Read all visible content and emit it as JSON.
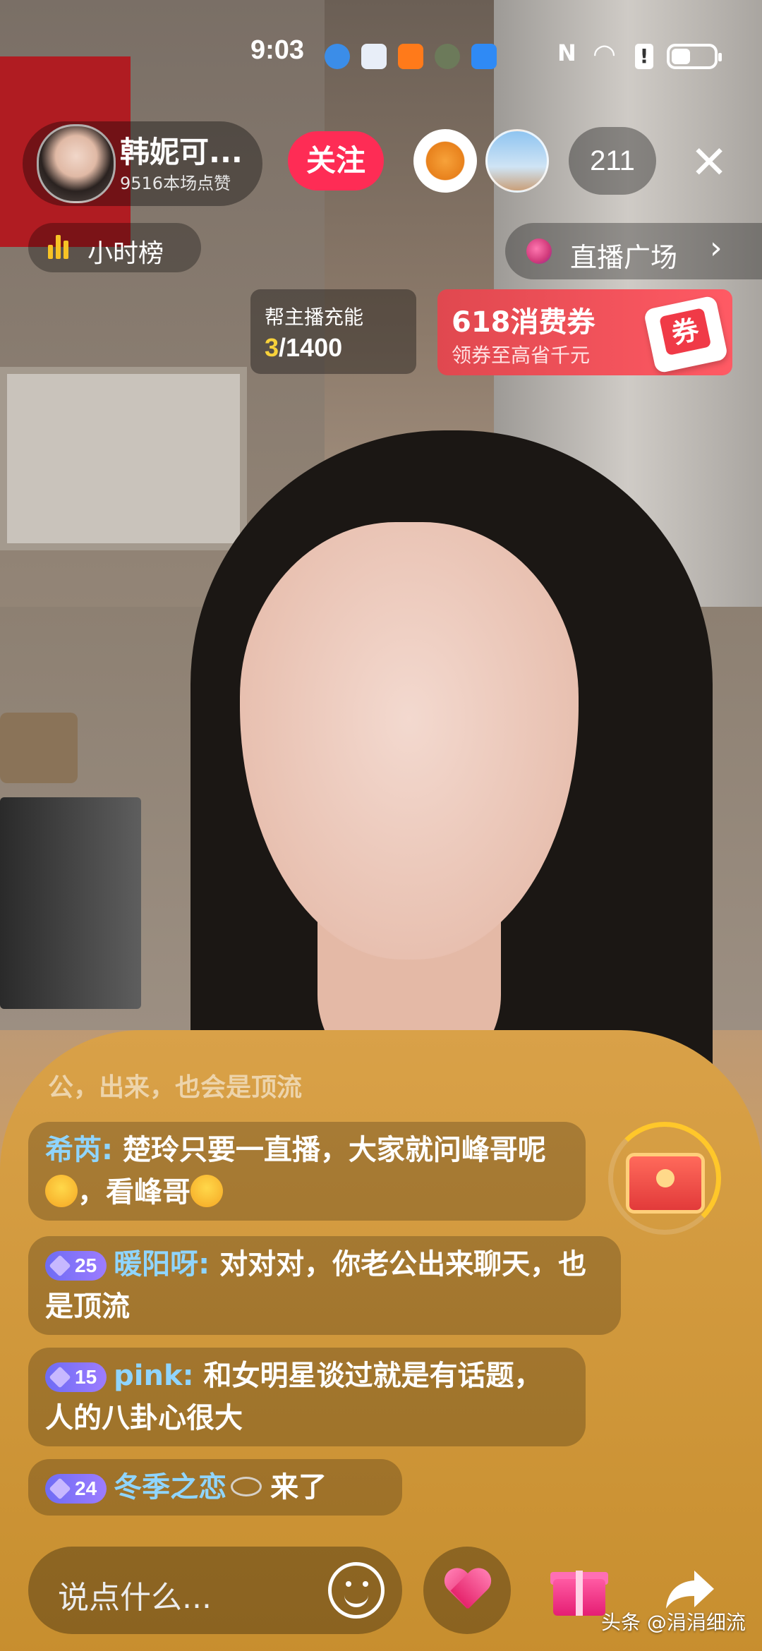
{
  "status_bar": {
    "time": "9:03",
    "nfc": "N"
  },
  "host": {
    "name": "韩妮可...",
    "likes": "9516本场点赞",
    "follow_label": "关注"
  },
  "viewers": {
    "count": "211"
  },
  "rank": {
    "label": "小时榜"
  },
  "plaza": {
    "label": "直播广场"
  },
  "energy": {
    "title": "帮主播充能",
    "current": "3",
    "total": "/1400"
  },
  "coupon": {
    "title": "618消费券",
    "subtitle": "领券至高省千元",
    "icon_text": "券"
  },
  "chat": {
    "ghost": "公，出来，也会是顶流",
    "messages": [
      {
        "level": "",
        "user": "希芮:",
        "text_a": "楚玲只要一直播，大家就问峰哥呢",
        "text_b": "，看峰哥"
      },
      {
        "level": "25",
        "user": "暖阳呀:",
        "text": "对对对，你老公出来聊天，也是顶流"
      },
      {
        "level": "15",
        "user": "pink:",
        "text": "和女明星谈过就是有话题，人的八卦心很大"
      },
      {
        "level": "24",
        "user": "冬季之恋",
        "text": "来了"
      }
    ]
  },
  "input": {
    "placeholder": "说点什么..."
  },
  "watermark": "头条 @涓涓细流",
  "icons": {
    "close": "close-icon",
    "smile": "smile-icon",
    "heart": "heart-icon",
    "gift": "gift-icon",
    "share": "share-icon",
    "treasure": "treasure-chest-icon"
  },
  "colors": {
    "follow": "#fe2c55",
    "username": "#8fd5ff",
    "energy_current": "#f8d23a"
  }
}
